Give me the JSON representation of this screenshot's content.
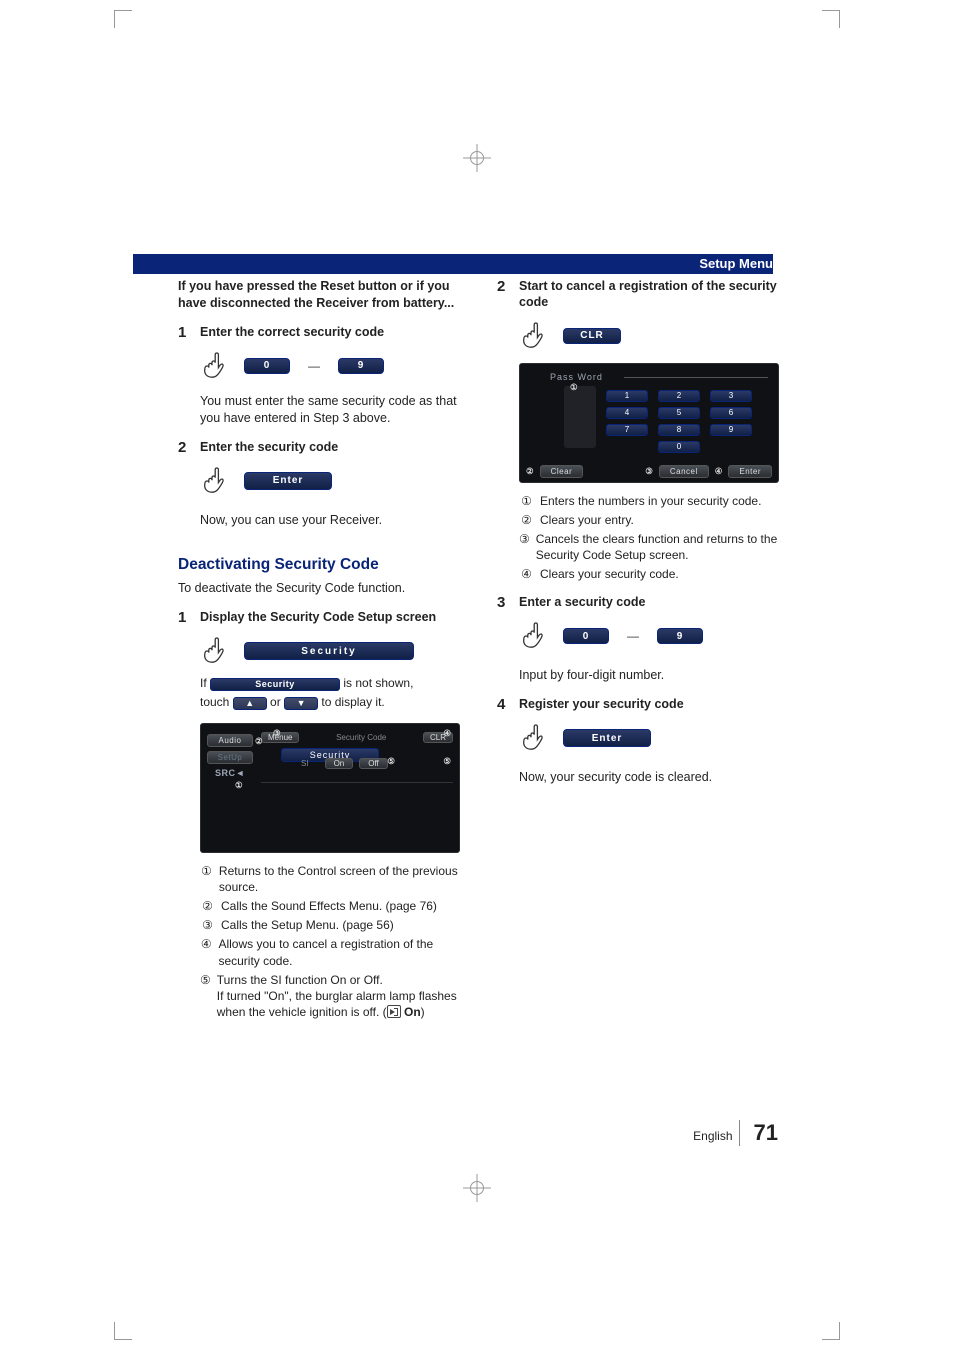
{
  "header": {
    "title": "Setup Menu"
  },
  "footer": {
    "lang": "English",
    "page": "71"
  },
  "left": {
    "intro": "If you have pressed the Reset button or if you have disconnected the Receiver from battery...",
    "step1": {
      "num": "1",
      "title": "Enter the correct security code",
      "key0": "0",
      "key9": "9",
      "dash": "—",
      "note": "You must enter the same security code as that you have entered in Step 3 above."
    },
    "step2": {
      "num": "2",
      "title": "Enter the security code",
      "enter": "Enter",
      "note": "Now, you can use your Receiver."
    },
    "section": "Deactivating Security Code",
    "section_sub": "To deactivate the Security Code function.",
    "d_step1": {
      "num": "1",
      "title": "Display the Security Code Setup screen",
      "security_btn": "Security",
      "if": "If",
      "mini_security": "Security",
      "not_shown": "is not shown,",
      "touch": "touch",
      "or": "or",
      "display_it": "to display it.",
      "arrow_up": "▲",
      "arrow_down": "▼"
    },
    "device1": {
      "audio": "Audio",
      "setup": "SetUp",
      "src": "SRC",
      "menue": "Menue",
      "title": "Security Code",
      "clr": "CLR",
      "si": "SI",
      "on": "On",
      "off": "Off",
      "footer_btn": "Security",
      "n1": "1",
      "n2": "2",
      "n3": "3",
      "n4": "4",
      "n5": "5"
    },
    "list": {
      "i1": "Returns to the Control screen of the previous source.",
      "i2": "Calls the Sound Effects Menu. (page 76)",
      "i3": "Calls the Setup Menu. (page 56)",
      "i4": "Allows you to cancel a registration of the security code.",
      "i5a": "Turns the SI function On or Off.",
      "i5b": "If turned  \"On\", the burglar alarm lamp flashes when the vehicle ignition is off. (",
      "i5c": "On",
      "i5d": ")",
      "n1": "1",
      "n2": "2",
      "n3": "3",
      "n4": "4",
      "n5": "5"
    }
  },
  "right": {
    "step2": {
      "num": "2",
      "title": "Start to cancel a registration of the security code",
      "clr": "CLR"
    },
    "device2": {
      "pass": "Pass Word",
      "k1": "1",
      "k2": "2",
      "k3": "3",
      "k4": "4",
      "k5": "5",
      "k6": "6",
      "k7": "7",
      "k8": "8",
      "k9": "9",
      "k0": "0",
      "clear": "Clear",
      "cancel": "Cancel",
      "enter": "Enter",
      "n1": "1",
      "n2": "2",
      "n3": "3",
      "n4": "4"
    },
    "list": {
      "i1": "Enters the numbers in your security code.",
      "i2": "Clears your entry.",
      "i3": "Cancels the clears function and returns to the Security Code Setup screen.",
      "i4": "Clears your security code.",
      "n1": "1",
      "n2": "2",
      "n3": "3",
      "n4": "4"
    },
    "step3": {
      "num": "3",
      "title": "Enter a security code",
      "key0": "0",
      "key9": "9",
      "dash": "—",
      "note": "Input by four-digit number."
    },
    "step4": {
      "num": "4",
      "title": "Register your security code",
      "enter": "Enter",
      "note": "Now, your security code is cleared."
    }
  }
}
